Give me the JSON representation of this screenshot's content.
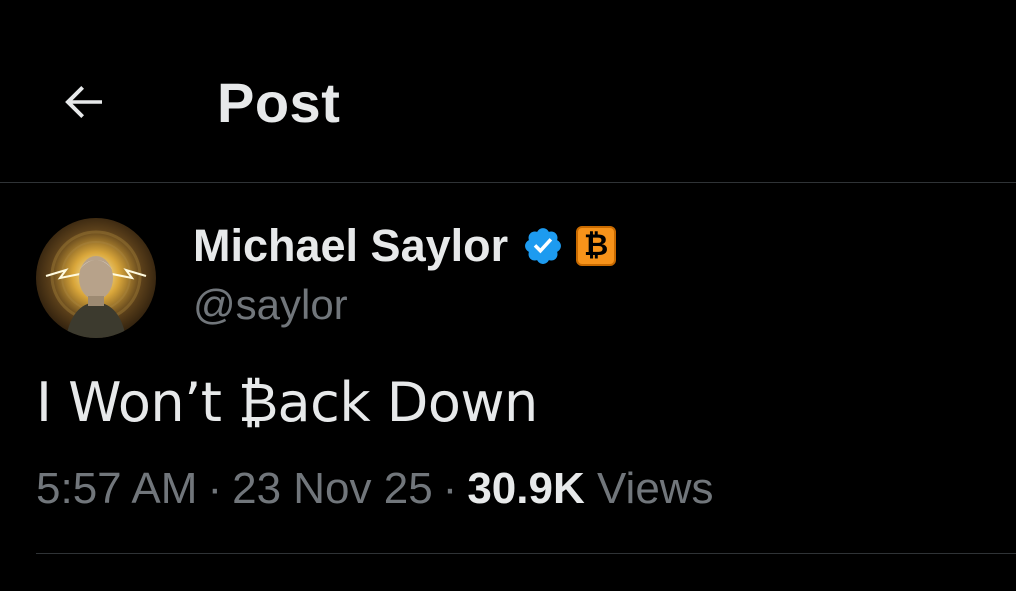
{
  "header": {
    "back_icon": "arrow-left-icon",
    "title": "Post"
  },
  "author": {
    "display_name": "Michael Saylor",
    "handle": "@saylor",
    "verified_icon": "verified-badge-icon",
    "verified_color": "#1d9bf0",
    "affiliate_badge": "₿",
    "affiliate_color": "#f7931a"
  },
  "post": {
    "text": "I Won’t ₿ack Down"
  },
  "meta": {
    "time": "5:57 AM",
    "separator": "·",
    "date": "23 Nov 25",
    "views_count": "30.9K",
    "views_label": "Views"
  },
  "colors": {
    "background": "#000000",
    "primary_text": "#e7e9ea",
    "secondary_text": "#71767b",
    "divider": "#2f3336"
  }
}
